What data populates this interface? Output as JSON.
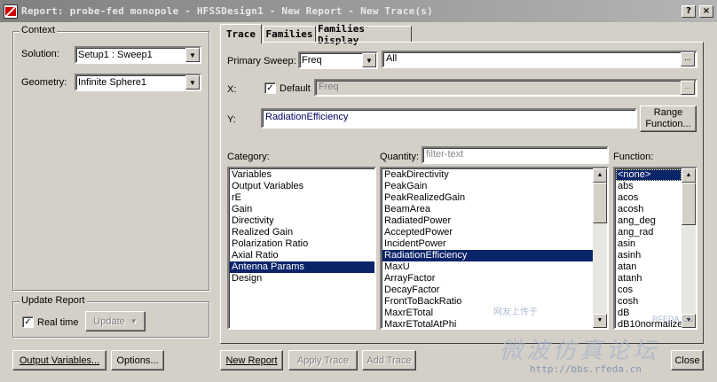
{
  "window": {
    "title": "Report: probe-fed monopole - HFSSDesign1 - New Report - New Trace(s)"
  },
  "titlebar_buttons": {
    "help": "?",
    "close": "×"
  },
  "context": {
    "label": "Context",
    "solution_label": "Solution:",
    "solution_value": "Setup1 : Sweep1",
    "geometry_label": "Geometry:",
    "geometry_value": "Infinite Sphere1"
  },
  "update_report": {
    "label": "Update Report",
    "realtime_label": "Real time",
    "realtime_checked": true,
    "update_button": "Update"
  },
  "tabs": [
    {
      "label": "Trace",
      "active": true
    },
    {
      "label": "Families",
      "active": false
    },
    {
      "label": "Families Display",
      "active": false
    }
  ],
  "trace": {
    "primary_sweep_label": "Primary Sweep:",
    "primary_sweep_value": "Freq",
    "primary_sweep_range": "All",
    "x_label": "X:",
    "x_default_label": "Default",
    "x_default_checked": true,
    "x_value": "Freq",
    "y_label": "Y:",
    "y_value": "RadiationEfficiency",
    "range_function_button": [
      "Range",
      "Function..."
    ],
    "category_label": "Category:",
    "quantity_label": "Quantity:",
    "quantity_filter_placeholder": "filter-text",
    "function_label": "Function:",
    "categories": [
      "Variables",
      "Output Variables",
      "rE",
      "Gain",
      "Directivity",
      "Realized Gain",
      "Polarization Ratio",
      "Axial Ratio",
      "Antenna Params",
      "Design"
    ],
    "category_selected_index": 8,
    "quantities": [
      "PeakDirectivity",
      "PeakGain",
      "PeakRealizedGain",
      "BeamArea",
      "RadiatedPower",
      "AcceptedPower",
      "IncidentPower",
      "RadiationEfficiency",
      "MaxU",
      "ArrayFactor",
      "DecayFactor",
      "FrontToBackRatio",
      "MaxrETotal",
      "MaxrETotalAtPhi"
    ],
    "quantity_selected_index": 7,
    "functions": [
      "<none>",
      "abs",
      "acos",
      "acosh",
      "ang_deg",
      "ang_rad",
      "asin",
      "asinh",
      "atan",
      "atanh",
      "cos",
      "cosh",
      "dB",
      "dB10normalize"
    ],
    "function_selected_index": 0
  },
  "bottom_buttons": {
    "output_variables": "Output Variables...",
    "options": "Options...",
    "new_report": "New Report",
    "apply_trace": "Apply Trace",
    "add_trace": "Add Trace",
    "close": "Close"
  },
  "watermark": {
    "main": "微波仿真论坛",
    "url": "http://bbs.rfeda.cn",
    "small": "网友上传于",
    "rfeda": "RFEDA.CN"
  }
}
